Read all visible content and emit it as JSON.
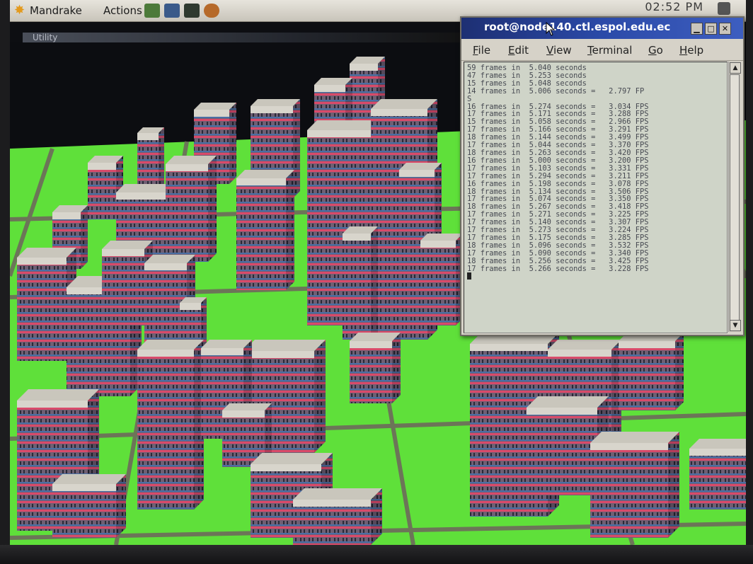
{
  "panel": {
    "menus": [
      "Mandrake",
      "Actions"
    ],
    "clock": "02:52 PM"
  },
  "background_window": {
    "title": "Utility"
  },
  "terminal": {
    "title": "root@node140.ctl.espol.edu.ec",
    "menu": [
      {
        "label": "File",
        "underline": "F",
        "rest": "ile"
      },
      {
        "label": "Edit",
        "underline": "E",
        "rest": "dit"
      },
      {
        "label": "View",
        "underline": "V",
        "rest": "iew"
      },
      {
        "label": "Terminal",
        "underline": "T",
        "rest": "erminal"
      },
      {
        "label": "Go",
        "underline": "G",
        "rest": "o"
      },
      {
        "label": "Help",
        "underline": "H",
        "rest": "elp"
      }
    ],
    "lines": [
      "59 frames in  5.040 seconds",
      "47 frames in  5.253 seconds",
      "15 frames in  5.048 seconds",
      "14 frames in  5.006 seconds =   2.797 FP",
      "S",
      "16 frames in  5.274 seconds =   3.034 FPS",
      "17 frames in  5.171 seconds =   3.288 FPS",
      "15 frames in  5.058 seconds =   2.966 FPS",
      "17 frames in  5.166 seconds =   3.291 FPS",
      "18 frames in  5.144 seconds =   3.499 FPS",
      "17 frames in  5.044 seconds =   3.370 FPS",
      "18 frames in  5.263 seconds =   3.420 FPS",
      "16 frames in  5.000 seconds =   3.200 FPS",
      "17 frames in  5.103 seconds =   3.331 FPS",
      "17 frames in  5.294 seconds =   3.211 FPS",
      "16 frames in  5.198 seconds =   3.078 FPS",
      "18 frames in  5.134 seconds =   3.506 FPS",
      "17 frames in  5.074 seconds =   3.350 FPS",
      "18 frames in  5.267 seconds =   3.418 FPS",
      "17 frames in  5.271 seconds =   3.225 FPS",
      "17 frames in  5.140 seconds =   3.307 FPS",
      "17 frames in  5.273 seconds =   3.224 FPS",
      "17 frames in  5.175 seconds =   3.285 FPS",
      "18 frames in  5.096 seconds =   3.532 FPS",
      "17 frames in  5.090 seconds =   3.340 FPS",
      "18 frames in  5.256 seconds =   3.425 FPS",
      "17 frames in  5.266 seconds =   3.228 FPS"
    ]
  },
  "colors": {
    "ground": "#5fe03a",
    "road": "#6e6a5c",
    "building_side": "#7a6a78",
    "building_stripe": "#d94a6a",
    "building_band": "#4a6fa5",
    "roof": "#c9c6bc",
    "titlebar": "#2b4aa8"
  },
  "icons": [
    "mandrake-star-icon",
    "launcher-icon",
    "terminal-icon",
    "tray-icon"
  ]
}
